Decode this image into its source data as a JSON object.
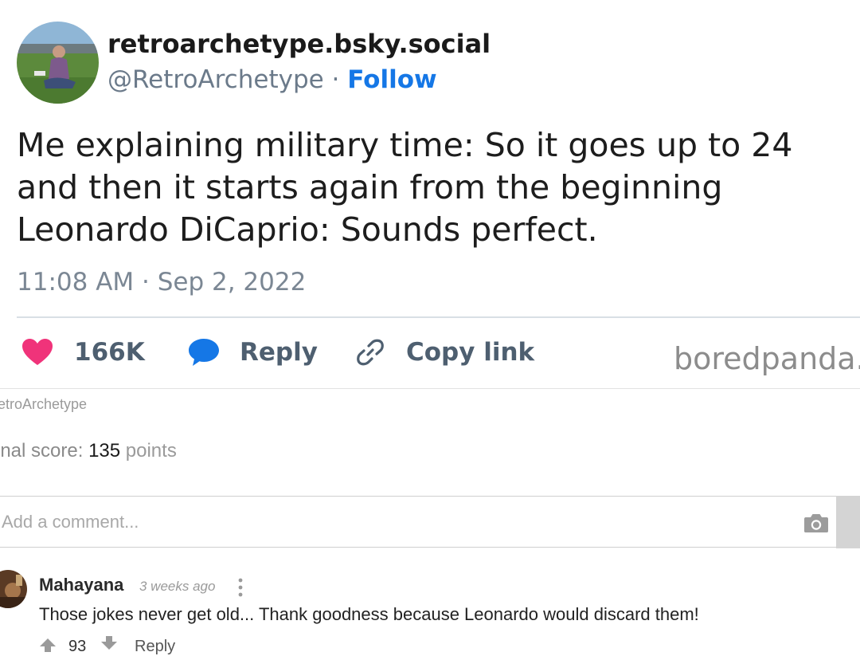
{
  "post": {
    "display_name": "retroarchetype.bsky.social",
    "handle": "@RetroArchetype",
    "separator": " · ",
    "follow_label": "Follow",
    "text_lines": [
      "Me explaining military time: So it goes up to 24",
      "and then it starts again from the beginning",
      "Leonardo DiCaprio: Sounds perfect."
    ],
    "timestamp": "11:08 AM · Sep 2, 2022",
    "actions": {
      "likes": "166K",
      "reply_label": "Reply",
      "copy_label": "Copy link"
    },
    "watermark": "boredpanda.c"
  },
  "source": {
    "handle": "etroArchetype"
  },
  "score": {
    "label": "inal score:",
    "value": "135",
    "unit": "points"
  },
  "comment_form": {
    "placeholder": "Add a comment..."
  },
  "comment": {
    "author": "Mahayana",
    "age": "3 weeks ago",
    "text": "Those jokes never get old... Thank goodness because Leonardo would discard them!",
    "votes": "93",
    "reply_label": "Reply"
  },
  "colors": {
    "like": "#f0337a",
    "reply_bubble": "#1577e6",
    "follow": "#1577e6"
  },
  "icons": [
    "heart-icon",
    "speech-bubble-icon",
    "link-icon",
    "camera-icon",
    "more-vertical-icon",
    "upvote-arrow-icon",
    "downvote-arrow-icon"
  ]
}
